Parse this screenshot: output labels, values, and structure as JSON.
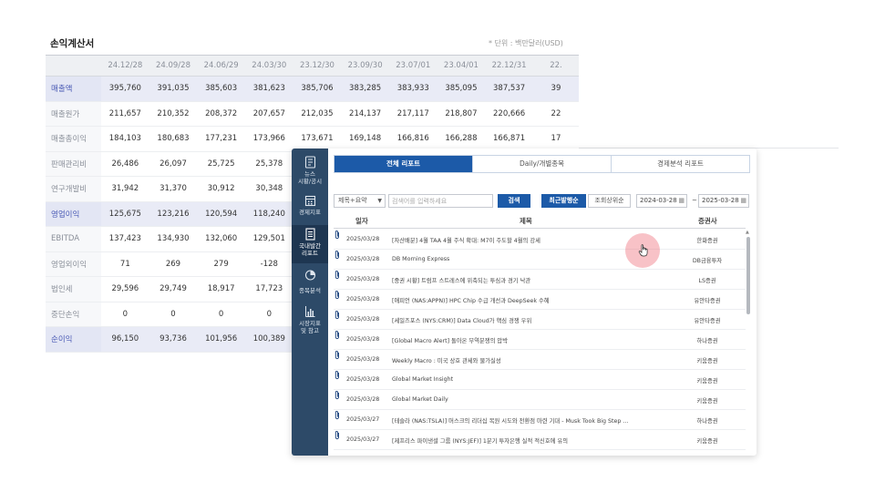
{
  "income_statement": {
    "title": "손익계산서",
    "unit": "* 단위 : 백만달러(USD)",
    "periods": [
      "24.12/28",
      "24.09/28",
      "24.06/29",
      "24.03/30",
      "23.12/30",
      "23.09/30",
      "23.07/01",
      "23.04/01",
      "22.12/31",
      "22."
    ],
    "rows": [
      {
        "label": "매출액",
        "values": [
          "395,760",
          "391,035",
          "385,603",
          "381,623",
          "385,706",
          "383,285",
          "383,933",
          "385,095",
          "387,537",
          "39"
        ]
      },
      {
        "label": "매출원가",
        "values": [
          "211,657",
          "210,352",
          "208,372",
          "207,657",
          "212,035",
          "214,137",
          "217,117",
          "218,807",
          "220,666",
          "22"
        ]
      },
      {
        "label": "매출총이익",
        "values": [
          "184,103",
          "180,683",
          "177,231",
          "173,966",
          "173,671",
          "169,148",
          "166,816",
          "166,288",
          "166,871",
          "17"
        ]
      },
      {
        "label": "판매관리비",
        "values": [
          "26,486",
          "26,097",
          "25,725",
          "25,378",
          "",
          "",
          "",
          "",
          "",
          ""
        ]
      },
      {
        "label": "연구개발비",
        "values": [
          "31,942",
          "31,370",
          "30,912",
          "30,348",
          "",
          "",
          "",
          "",
          "",
          ""
        ]
      },
      {
        "label": "영업이익",
        "values": [
          "125,675",
          "123,216",
          "120,594",
          "118,240",
          "",
          "",
          "",
          "",
          "",
          ""
        ]
      },
      {
        "label": "EBITDA",
        "values": [
          "137,423",
          "134,930",
          "132,060",
          "129,501",
          "",
          "",
          "",
          "",
          "",
          ""
        ]
      },
      {
        "label": "영업외이익",
        "values": [
          "71",
          "269",
          "279",
          "-128",
          "",
          "",
          "",
          "",
          "",
          ""
        ]
      },
      {
        "label": "법인세",
        "values": [
          "29,596",
          "29,749",
          "18,917",
          "17,723",
          "",
          "",
          "",
          "",
          "",
          ""
        ]
      },
      {
        "label": "중단손익",
        "values": [
          "0",
          "0",
          "0",
          "0",
          "",
          "",
          "",
          "",
          "",
          ""
        ]
      },
      {
        "label": "순이익",
        "values": [
          "96,150",
          "93,736",
          "101,956",
          "100,389",
          "",
          "",
          "",
          "",
          "",
          ""
        ]
      }
    ],
    "highlight_rows": [
      0,
      5,
      10
    ]
  },
  "sidebar": {
    "items": [
      {
        "label1": "뉴스",
        "label2": "시황/공시",
        "icon": "news-icon"
      },
      {
        "label1": "경제지표",
        "label2": "",
        "icon": "calendar-icon"
      },
      {
        "label1": "국내발간",
        "label2": "리포트",
        "icon": "report-icon",
        "active": true
      },
      {
        "label1": "종목분석",
        "label2": "",
        "icon": "pie-chart-icon"
      },
      {
        "label1": "시장지표",
        "label2": "및 참고",
        "icon": "bar-chart-icon"
      }
    ]
  },
  "tabs": [
    "전체 리포트",
    "Daily/개별종목",
    "경제분석 리포트"
  ],
  "search": {
    "filter_value": "제목+요약",
    "placeholder": "검색어를 입력하세요",
    "button": "검색",
    "sort_recent": "최근발행순",
    "sort_views": "조회상위순",
    "date_from": "2024-03-28",
    "date_to": "2025-03-28",
    "tilde": "~"
  },
  "list": {
    "headers": {
      "date": "일자",
      "title": "제목",
      "broker": "증권사"
    },
    "reports": [
      {
        "date": "2025/03/28",
        "title": "[자산배분] 4월 TAA 4월 주식 확대: M7이 주도할 4월의 강세",
        "broker": "한화증권"
      },
      {
        "date": "2025/03/28",
        "title": "DB Morning Express",
        "broker": "DB금융투자"
      },
      {
        "date": "2025/03/28",
        "title": "[중권 시황] 트럼프 스트레스에 위축되는 투심과 경기 낙관",
        "broker": "LS증권"
      },
      {
        "date": "2025/03/28",
        "title": "[애피언 (NAS:APPN)] HPC Chip 수급 개선과 DeepSeek 수혜",
        "broker": "유안타증권"
      },
      {
        "date": "2025/03/28",
        "title": "[세일즈포스 (NYS:CRM)] Data Cloud가 핵심 경쟁 우위",
        "broker": "유안타증권"
      },
      {
        "date": "2025/03/28",
        "title": "[Global Macro Alert] 돌아온 무역분쟁의 압박",
        "broker": "하나증권"
      },
      {
        "date": "2025/03/28",
        "title": "Weekly Macro : 미국 상호 관세와 물가실성",
        "broker": "키움증권"
      },
      {
        "date": "2025/03/28",
        "title": "Global Market Insight",
        "broker": "키움증권"
      },
      {
        "date": "2025/03/28",
        "title": "Global Market Daily",
        "broker": "키움증권"
      },
      {
        "date": "2025/03/27",
        "title": "[테슬라 (NAS:TSLA)] 머스크의 리더십 복원 시도와 전환점 마련 기대 - Musk Took Big Step ...",
        "broker": "하나증권"
      },
      {
        "date": "2025/03/27",
        "title": "[제프리스 파이낸셜 그룹 (NYS:JEF)] 1분기 투자은행 실적 적신호에 유의",
        "broker": "키움증권"
      }
    ]
  }
}
